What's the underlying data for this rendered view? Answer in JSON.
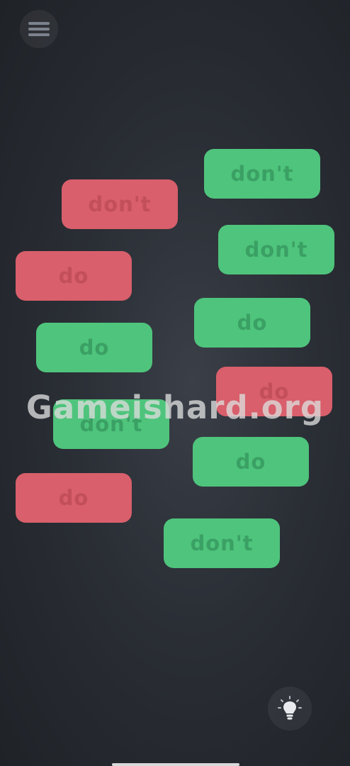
{
  "tiles": [
    {
      "label": "don't",
      "color": "green"
    },
    {
      "label": "don't",
      "color": "red"
    },
    {
      "label": "don't",
      "color": "green"
    },
    {
      "label": "do",
      "color": "red"
    },
    {
      "label": "do",
      "color": "green"
    },
    {
      "label": "do",
      "color": "green"
    },
    {
      "label": "do",
      "color": "red"
    },
    {
      "label": "don't",
      "color": "green"
    },
    {
      "label": "do",
      "color": "green"
    },
    {
      "label": "do",
      "color": "red"
    },
    {
      "label": "don't",
      "color": "green"
    }
  ],
  "watermark": "Gameishard.org",
  "icons": {
    "menu": "hamburger-menu-icon",
    "hint": "lightbulb-icon"
  },
  "colors": {
    "red_tile": "#d85f6b",
    "green_tile": "#4fc47c",
    "background": "#2a2e35"
  }
}
